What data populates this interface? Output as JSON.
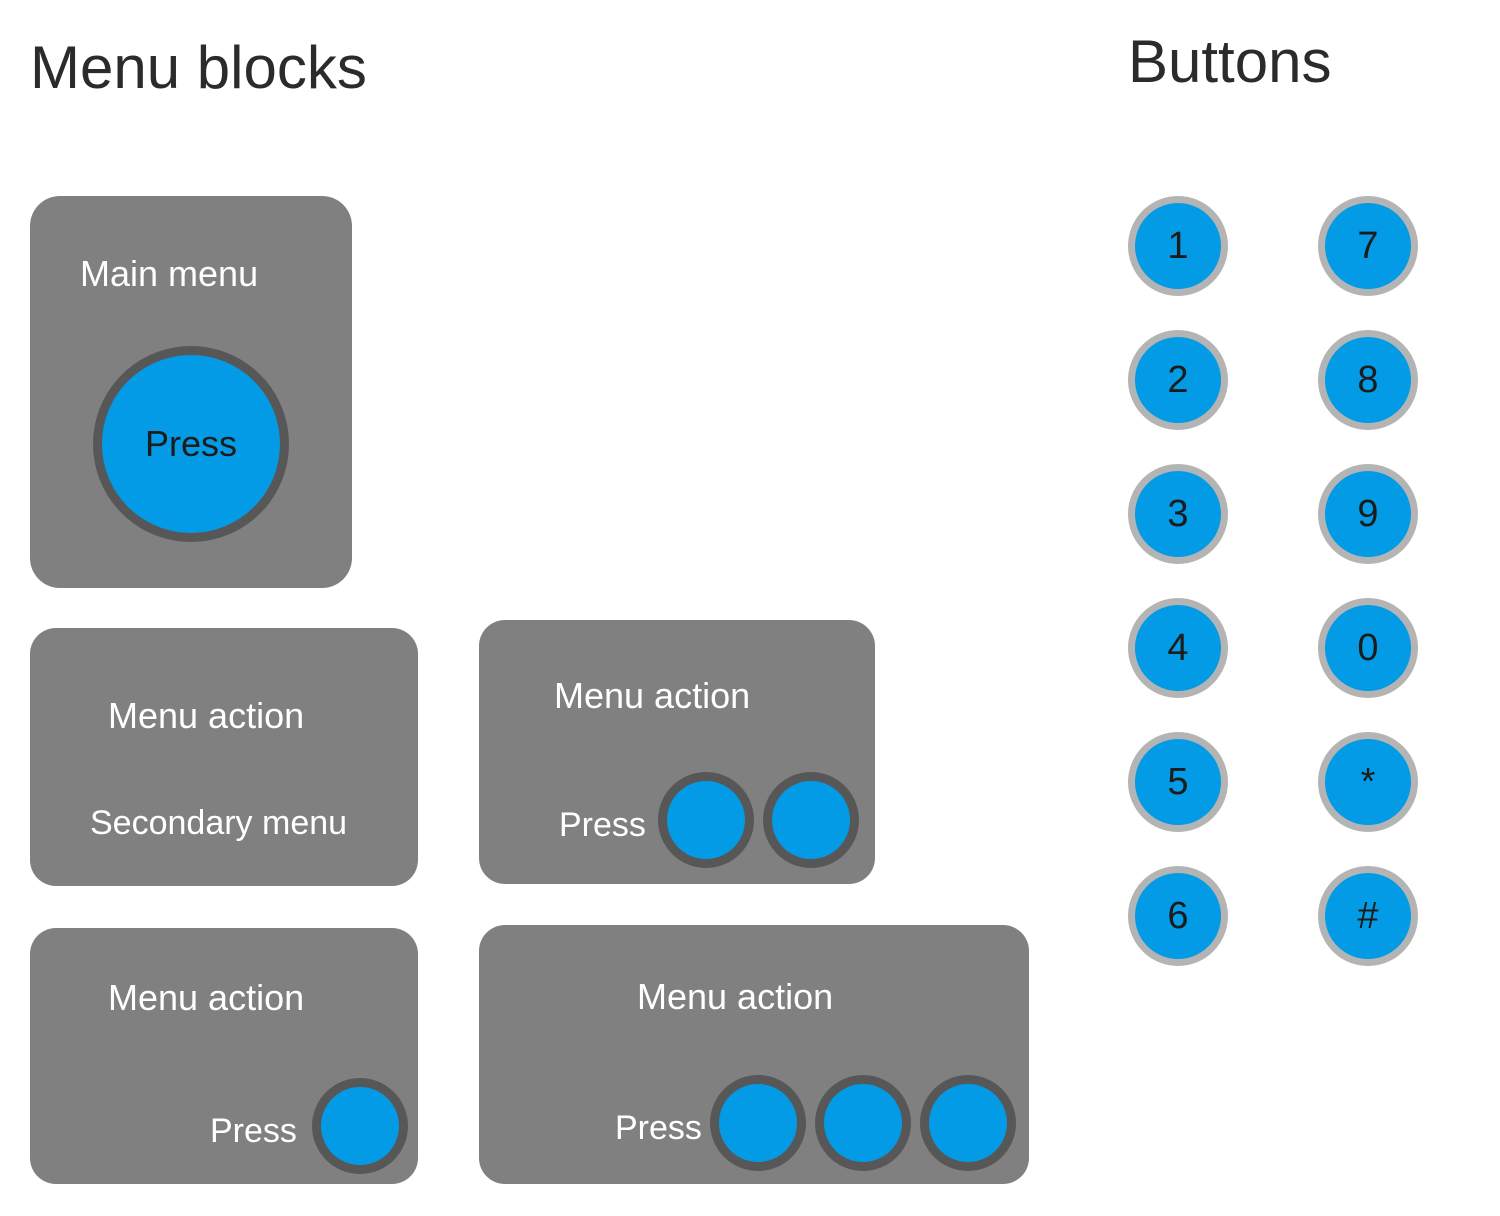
{
  "page": {
    "background_color": "#ffffff"
  },
  "headings": {
    "menu_blocks": "Menu blocks",
    "buttons": "Buttons"
  },
  "palette": {
    "block_gray": "#808080",
    "button_blue": "#039be5",
    "block_circle_border": "#575757",
    "keypad_border": "#b4b4b4",
    "heading_text": "#2b2b2b",
    "block_text": "#ffffff",
    "circle_text": "#1c1c1c"
  },
  "menu_blocks": [
    {
      "id": "main-menu",
      "title": "Main menu",
      "press_button_label": "Press",
      "circle_count": 1
    },
    {
      "id": "secondary",
      "title": "Menu action",
      "subtitle": "Secondary menu",
      "circle_count": 0
    },
    {
      "id": "two-buttons",
      "title": "Menu action",
      "press_label": "Press",
      "circle_count": 2
    },
    {
      "id": "one-button",
      "title": "Menu action",
      "press_label": "Press",
      "circle_count": 1
    },
    {
      "id": "three-buttons",
      "title": "Menu action",
      "press_label": "Press",
      "circle_count": 3
    }
  ],
  "keypad": {
    "left_column": [
      "1",
      "2",
      "3",
      "4",
      "5",
      "6"
    ],
    "right_column": [
      "7",
      "8",
      "9",
      "0",
      "*",
      "#"
    ]
  }
}
